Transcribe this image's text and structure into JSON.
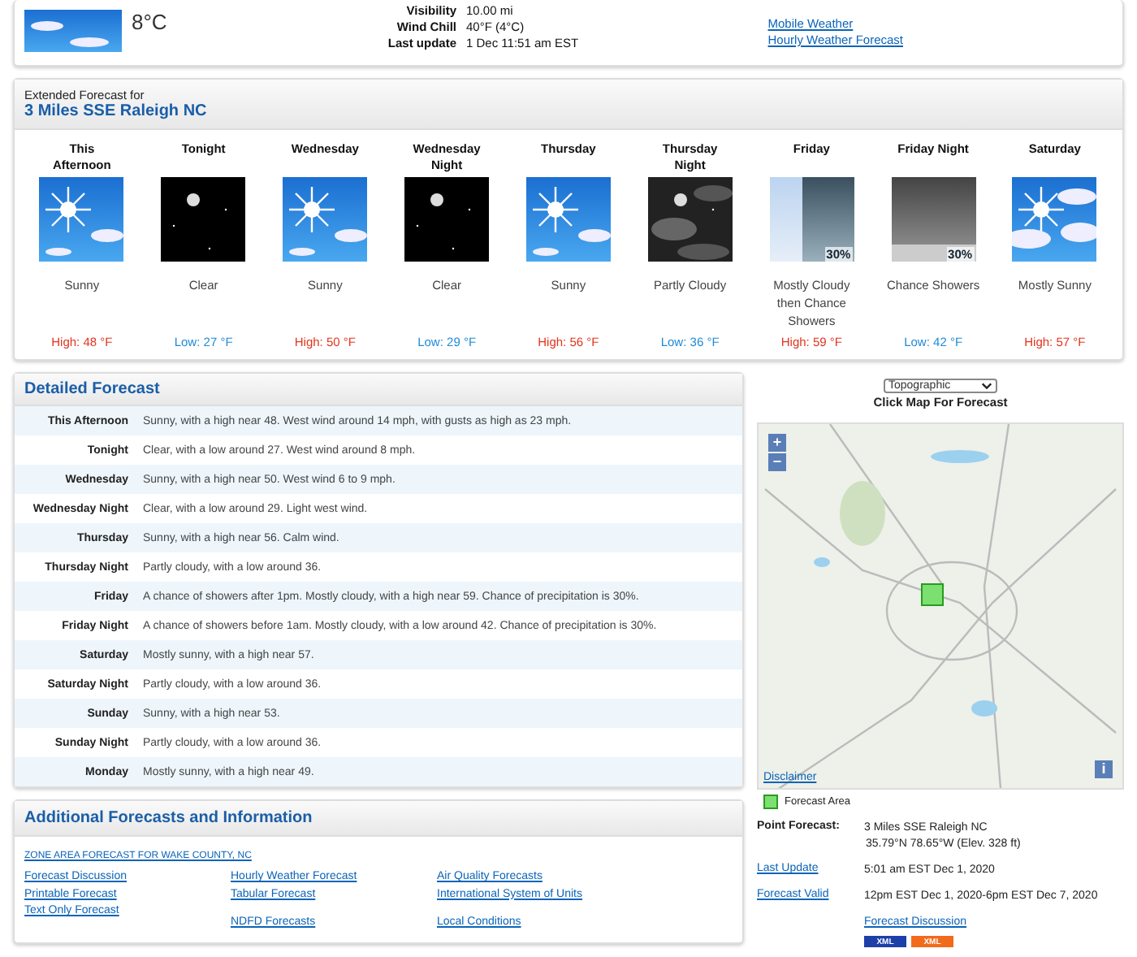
{
  "current": {
    "kind": "few-clouds",
    "temperature": "8°C",
    "details": [
      {
        "label": "Visibility",
        "value": "10.00 mi"
      },
      {
        "label": "Wind Chill",
        "value": "40°F (4°C)"
      },
      {
        "label": "Last update",
        "value": "1 Dec 11:51 am EST"
      }
    ],
    "links": [
      "Mobile Weather",
      "Hourly Weather Forecast"
    ]
  },
  "extended": {
    "caption": "Extended Forecast for",
    "location": "3 Miles SSE Raleigh NC",
    "periods": [
      {
        "name": "This Afternoon",
        "kind": "sunny",
        "summary": "Sunny",
        "high": {
          "kind": "high",
          "text": "High: 48 °F"
        }
      },
      {
        "name": "Tonight",
        "kind": "clear-night",
        "summary": "Clear",
        "high": {
          "kind": "low",
          "text": "Low: 27 °F"
        }
      },
      {
        "name": "Wednesday",
        "kind": "sunny",
        "summary": "Sunny",
        "high": {
          "kind": "high",
          "text": "High: 50 °F"
        }
      },
      {
        "name": "Wednesday Night",
        "kind": "clear-night",
        "summary": "Clear",
        "high": {
          "kind": "low",
          "text": "Low: 29 °F"
        }
      },
      {
        "name": "Thursday",
        "kind": "sunny",
        "summary": "Sunny",
        "high": {
          "kind": "high",
          "text": "High: 56 °F"
        }
      },
      {
        "name": "Thursday Night",
        "kind": "cloudy-night",
        "summary": "Partly Cloudy",
        "high": {
          "kind": "low",
          "text": "Low: 36 °F"
        }
      },
      {
        "name": "Friday",
        "kind": "cloud-showers",
        "badge": "30%",
        "summary": "Mostly Cloudy then Chance Showers",
        "high": {
          "kind": "high",
          "text": "High: 59 °F"
        }
      },
      {
        "name": "Friday Night",
        "kind": "showers",
        "badge": "30%",
        "summary": "Chance Showers",
        "high": {
          "kind": "low",
          "text": "Low: 42 °F"
        }
      },
      {
        "name": "Saturday",
        "kind": "mostly-sunny",
        "summary": "Mostly Sunny",
        "high": {
          "kind": "high",
          "text": "High: 57 °F"
        }
      }
    ]
  },
  "detailed": {
    "title": "Detailed Forecast",
    "rows": [
      {
        "period": "This Afternoon",
        "text": "Sunny, with a high near 48. West wind around 14 mph, with gusts as high as 23 mph."
      },
      {
        "period": "Tonight",
        "text": "Clear, with a low around 27. West wind around 8 mph."
      },
      {
        "period": "Wednesday",
        "text": "Sunny, with a high near 50. West wind 6 to 9 mph."
      },
      {
        "period": "Wednesday Night",
        "text": "Clear, with a low around 29. Light west wind."
      },
      {
        "period": "Thursday",
        "text": "Sunny, with a high near 56. Calm wind."
      },
      {
        "period": "Thursday Night",
        "text": "Partly cloudy, with a low around 36."
      },
      {
        "period": "Friday",
        "text": "A chance of showers after 1pm. Mostly cloudy, with a high near 59. Chance of precipitation is 30%."
      },
      {
        "period": "Friday Night",
        "text": "A chance of showers before 1am. Mostly cloudy, with a low around 42. Chance of precipitation is 30%."
      },
      {
        "period": "Saturday",
        "text": "Mostly sunny, with a high near 57."
      },
      {
        "period": "Saturday Night",
        "text": "Partly cloudy, with a low around 36."
      },
      {
        "period": "Sunday",
        "text": "Sunny, with a high near 53."
      },
      {
        "period": "Sunday Night",
        "text": "Partly cloudy, with a low around 36."
      },
      {
        "period": "Monday",
        "text": "Mostly sunny, with a high near 49."
      }
    ]
  },
  "map": {
    "layer": "Topographic",
    "caption": "Click Map For Forecast",
    "zoom_in": "+",
    "zoom_out": "−",
    "info": "i",
    "disclaimer": "Disclaimer",
    "legend": "Forecast Area"
  },
  "point_info": [
    {
      "label": "Point Forecast:",
      "link": false,
      "lines": [
        "3 Miles SSE Raleigh NC",
        "35.79°N 78.65°W (Elev. 328 ft)"
      ]
    },
    {
      "label": "Last Update",
      "link": true,
      "lines": [
        "5:01 am EST Dec 1, 2020"
      ]
    },
    {
      "label": "Forecast Valid",
      "link": true,
      "lines": [
        "12pm EST Dec 1, 2020-6pm EST Dec 7, 2020"
      ]
    }
  ],
  "point_link": "Forecast Discussion",
  "xml_buttons": [
    {
      "label": "XML",
      "color": "#1c3fa8"
    },
    {
      "label": "XML",
      "color": "#f26a1b"
    }
  ],
  "additional": {
    "title": "Additional Forecasts and Information",
    "zone_link": "ZONE AREA FORECAST FOR WAKE COUNTY, NC",
    "columns": [
      [
        "Forecast Discussion",
        "Printable Forecast",
        "Text Only Forecast"
      ],
      [
        "Hourly Weather Forecast",
        "Tabular Forecast",
        null,
        "NDFD Forecasts"
      ],
      [
        "Air Quality Forecasts",
        "International System of Units",
        null,
        "Local Conditions"
      ]
    ]
  }
}
